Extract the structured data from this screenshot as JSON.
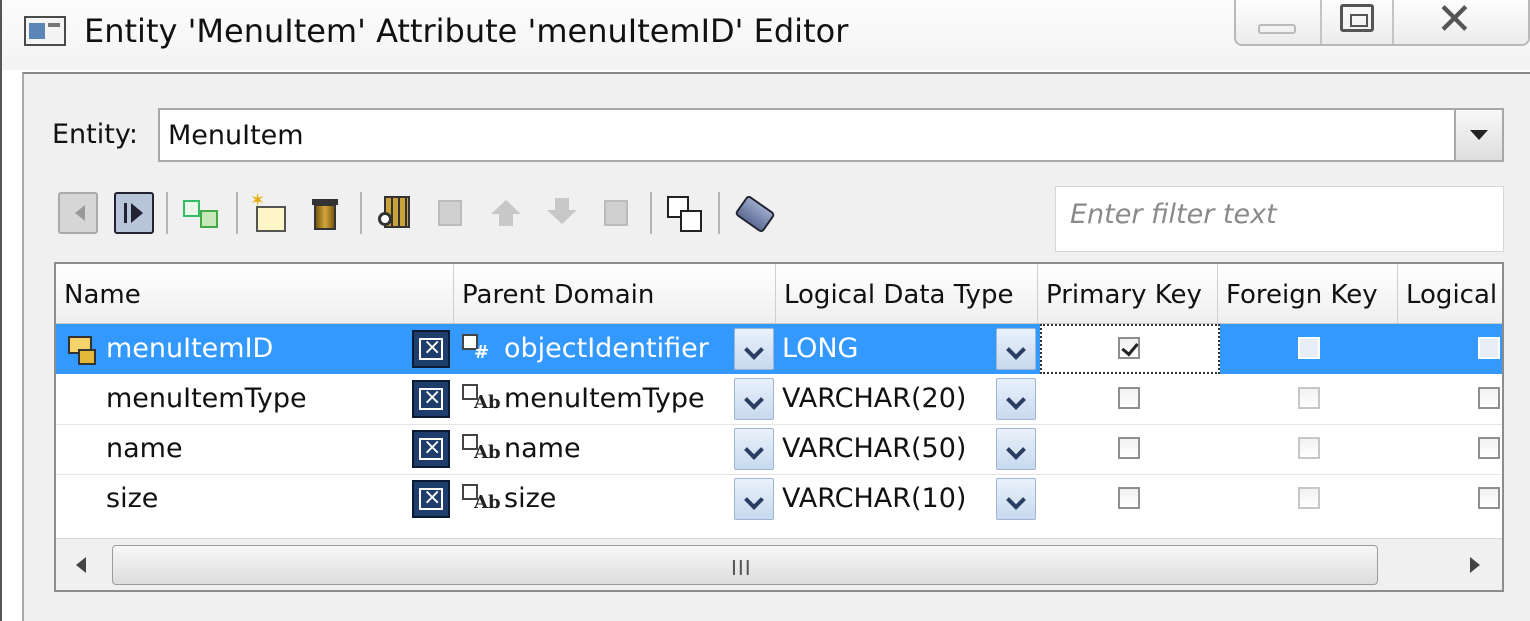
{
  "window": {
    "title": "Entity 'MenuItem' Attribute 'menuItemID' Editor"
  },
  "entity": {
    "label": "Entity:",
    "value": "MenuItem"
  },
  "toolbar": {
    "icons": [
      "previous-icon",
      "next-icon",
      "hierarchy-icon",
      "new-attribute-icon",
      "delete-icon",
      "reorder-icon",
      "move-top-icon",
      "move-up-icon",
      "move-down-icon",
      "move-bottom-icon",
      "copy-icon",
      "tag-icon"
    ]
  },
  "filter": {
    "placeholder": "Enter filter text"
  },
  "table": {
    "columns": [
      "Name",
      "Parent Domain",
      "Logical Data Type",
      "Primary Key",
      "Foreign Key",
      "Logical"
    ],
    "rows": [
      {
        "name": "menuItemID",
        "domain": "objectIdentifier",
        "type": "LONG",
        "primary_key": true,
        "foreign_key": false,
        "logical": false,
        "selected": true
      },
      {
        "name": "menuItemType",
        "domain": "menuItemType",
        "type": "VARCHAR(20)",
        "primary_key": false,
        "foreign_key": false,
        "logical": false,
        "selected": false
      },
      {
        "name": "name",
        "domain": "name",
        "type": "VARCHAR(50)",
        "primary_key": false,
        "foreign_key": false,
        "logical": false,
        "selected": false
      },
      {
        "name": "size",
        "domain": "size",
        "type": "VARCHAR(10)",
        "primary_key": false,
        "foreign_key": false,
        "logical": false,
        "selected": false
      }
    ]
  },
  "scrollbar": {
    "grip": "III"
  },
  "colors": {
    "selection": "#3399ff",
    "window_bg": "#f0f0f0"
  }
}
